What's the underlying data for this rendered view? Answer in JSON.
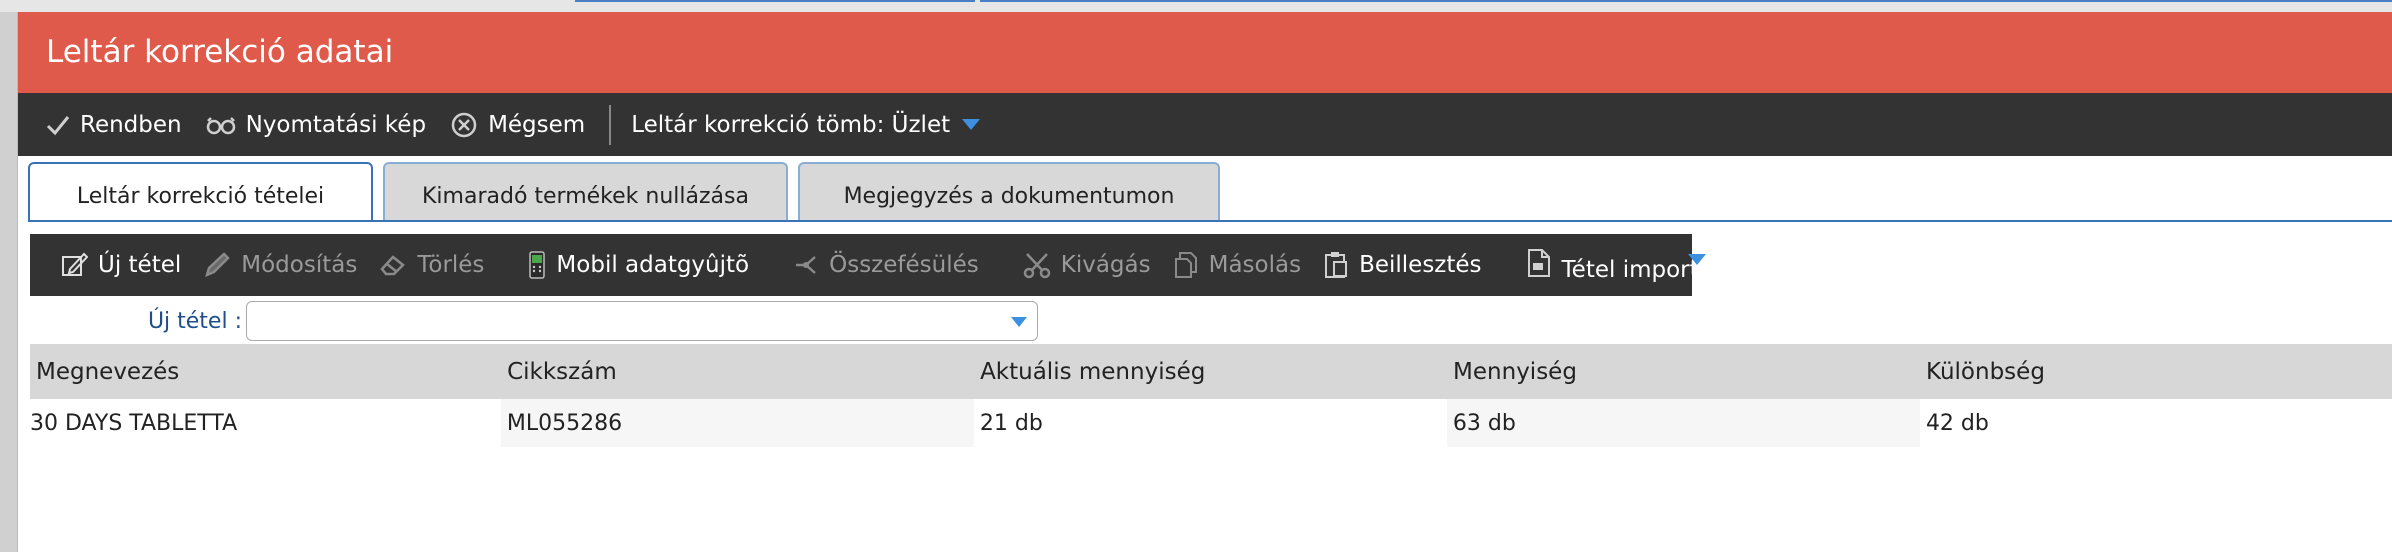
{
  "window": {
    "title": "Leltár korrekció adatai"
  },
  "toolbar": {
    "ok_label": "Rendben",
    "print_label": "Nyomtatási kép",
    "cancel_label": "Mégsem",
    "block_label": "Leltár korrekció tömb: Üzlet"
  },
  "tabs": [
    {
      "label": "Leltár korrekció tételei",
      "active": true
    },
    {
      "label": "Kimaradó termékek nullázása",
      "active": false
    },
    {
      "label": "Megjegyzés a dokumentumon",
      "active": false
    }
  ],
  "subtoolbar": {
    "new_item": "Új tétel",
    "modify": "Módosítás",
    "delete": "Törlés",
    "mobile": "Mobil adatgyûjtõ",
    "merge": "Összefésülés",
    "cut": "Kivágás",
    "copy": "Másolás",
    "paste": "Beillesztés",
    "import": "Tétel import"
  },
  "new_item_field": {
    "label": "Új tétel :",
    "value": ""
  },
  "grid": {
    "columns": [
      "Megnevezés",
      "Cikkszám",
      "Aktuális mennyiség",
      "Mennyiség",
      "Különbség"
    ],
    "rows": [
      [
        "30 DAYS TABLETTA",
        "ML055286",
        "21 db",
        "63 db",
        "42 db"
      ]
    ]
  },
  "colors": {
    "titlebar": "#e05a4b",
    "toolbar": "#333333",
    "accent": "#3d8fe0"
  }
}
